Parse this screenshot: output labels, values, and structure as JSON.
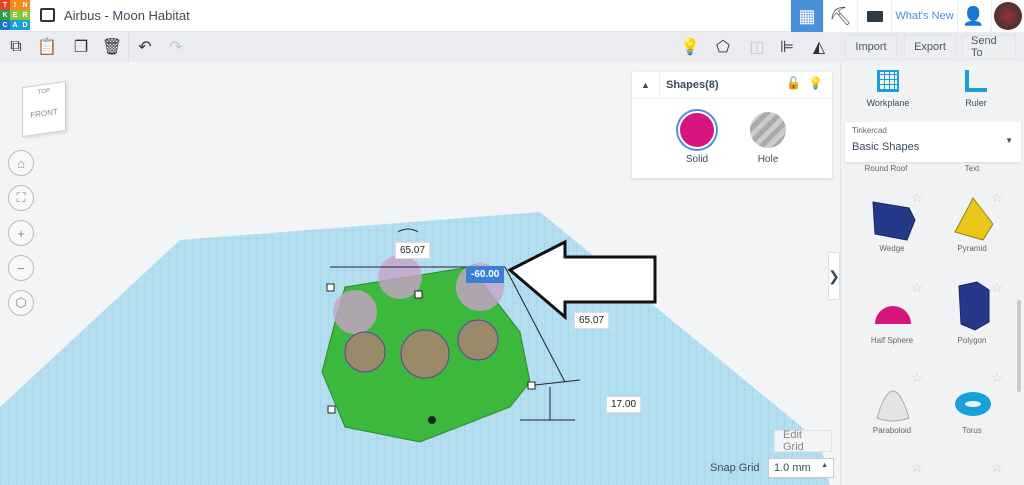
{
  "app": {
    "logo_letters": [
      "T",
      "I",
      "N",
      "K",
      "E",
      "R",
      "C",
      "A",
      "D"
    ],
    "title": "Airbus - Moon Habitat",
    "whats_new": "What's New"
  },
  "toolbar": {
    "import": "Import",
    "export": "Export",
    "send_to": "Send To"
  },
  "shapes_panel": {
    "title": "Shapes(8)",
    "solid": "Solid",
    "hole": "Hole",
    "solid_color": "#d6157e"
  },
  "viewcube": {
    "top": "TOP",
    "front": "FRONT"
  },
  "dimensions": {
    "width": "65.07",
    "rotation": "-60.00",
    "depth": "65.07",
    "height": "17.00"
  },
  "viewport": {
    "edit_grid": "Edit Grid",
    "snap_grid_label": "Snap Grid",
    "snap_grid_value": "1.0 mm"
  },
  "library": {
    "workplane": "Workplane",
    "ruler": "Ruler",
    "provider": "Tinkercad",
    "category": "Basic Shapes",
    "items": [
      {
        "label": "Round Roof"
      },
      {
        "label": "Text"
      },
      {
        "label": "Wedge"
      },
      {
        "label": "Pyramid"
      },
      {
        "label": "Half Sphere"
      },
      {
        "label": "Polygon"
      },
      {
        "label": "Paraboloid"
      },
      {
        "label": "Torus"
      }
    ]
  }
}
